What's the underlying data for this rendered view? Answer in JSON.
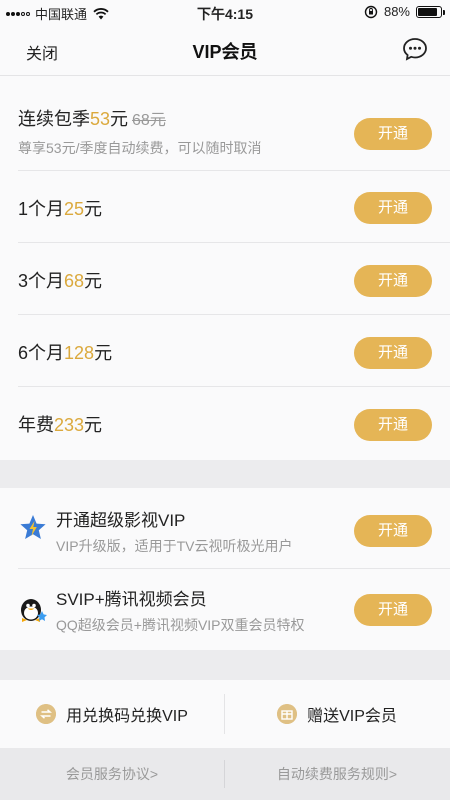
{
  "status_bar": {
    "carrier": "中国联通",
    "time": "下午4:15",
    "battery": "88%",
    "battery_level": 0.88
  },
  "nav": {
    "close": "关闭",
    "title": "VIP会员",
    "more_icon": "chat-bubble-icon"
  },
  "plans": [
    {
      "name_prefix": "连续包季",
      "price": "53",
      "unit": "元",
      "original_price": "68元",
      "description": "尊享53元/季度自动续费，可以随时取消",
      "button": "开通"
    },
    {
      "name_prefix": "1个月",
      "price": "25",
      "unit": "元",
      "button": "开通"
    },
    {
      "name_prefix": "3个月",
      "price": "68",
      "unit": "元",
      "button": "开通"
    },
    {
      "name_prefix": "6个月",
      "price": "128",
      "unit": "元",
      "button": "开通"
    },
    {
      "name_prefix": "年费",
      "price": "233",
      "unit": "元",
      "button": "开通"
    }
  ],
  "premium": [
    {
      "icon": "star-vip-icon",
      "title": "开通超级影视VIP",
      "description": "VIP升级版，适用于TV云视听极光用户",
      "button": "开通"
    },
    {
      "icon": "qq-penguin-icon",
      "title": "SVIP+腾讯视频会员",
      "description": "QQ超级会员+腾讯视频VIP双重会员特权",
      "button": "开通"
    }
  ],
  "actions": {
    "redeem": "用兑换码兑换VIP",
    "gift": "赠送VIP会员"
  },
  "links": {
    "agreement": "会员服务协议>",
    "auto_renew_rules": "自动续费服务规则>"
  },
  "colors": {
    "accent": "#e5b556",
    "price": "#dba93d"
  }
}
